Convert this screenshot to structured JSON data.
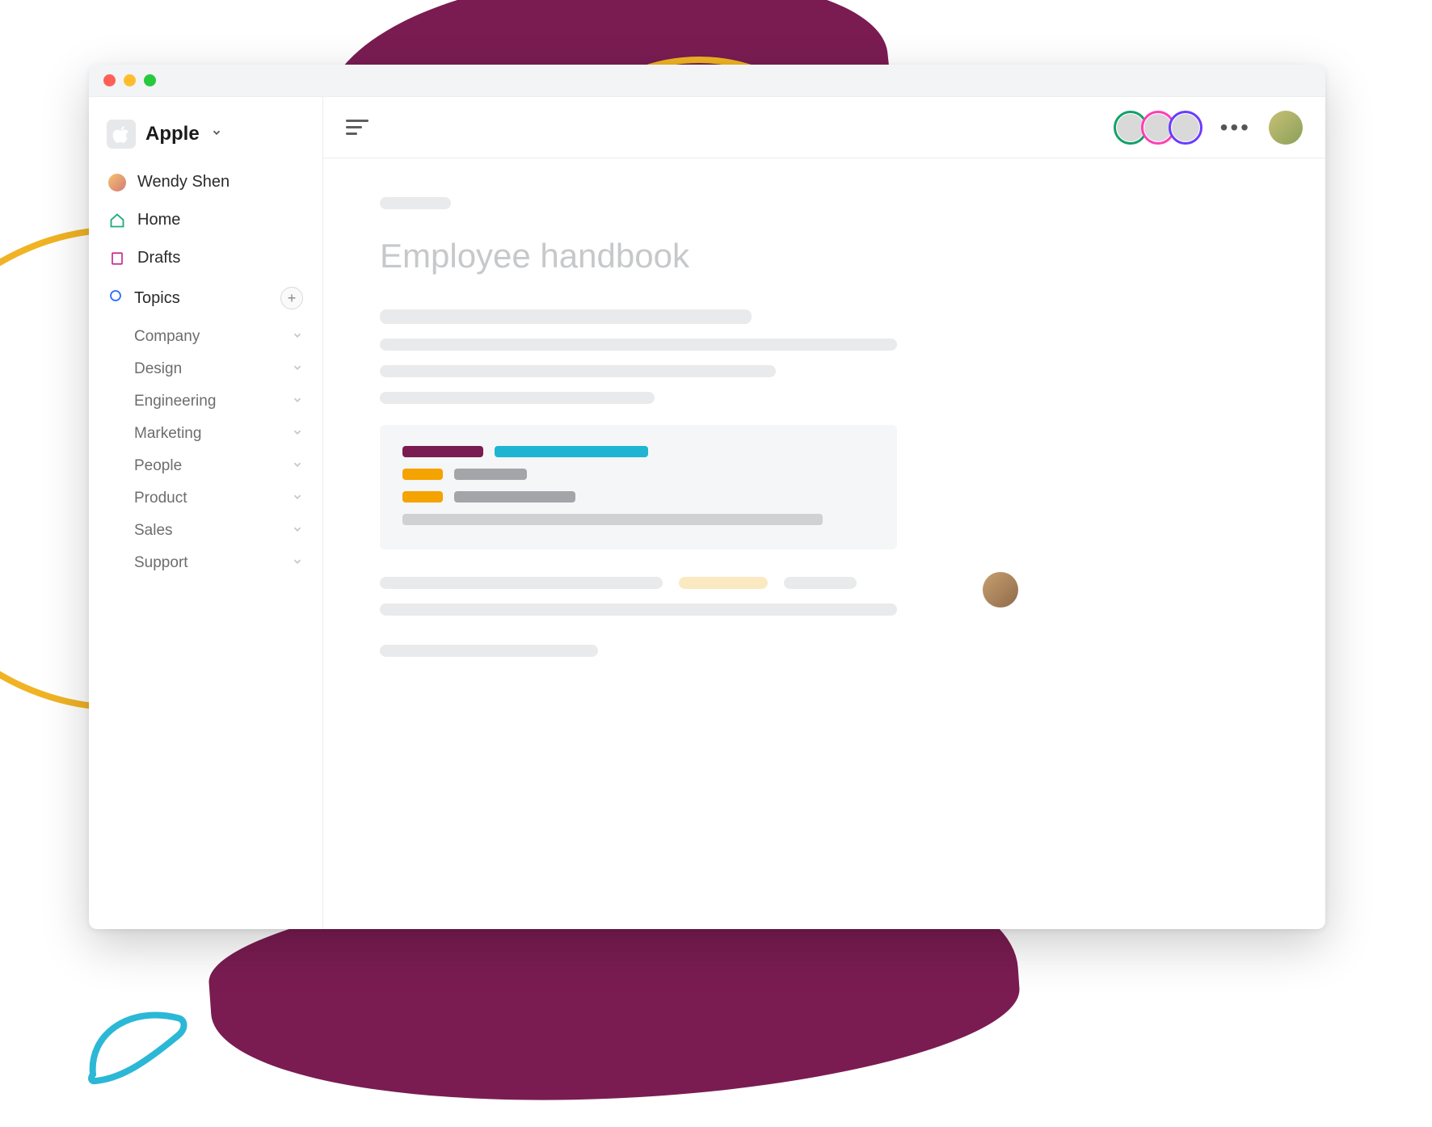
{
  "workspace": {
    "name": "Apple",
    "logo_icon": "apple-icon"
  },
  "sidebar": {
    "user_name": "Wendy Shen",
    "nav": {
      "home": "Home",
      "drafts": "Drafts",
      "topics": "Topics"
    },
    "topics": [
      {
        "label": "Company"
      },
      {
        "label": "Design"
      },
      {
        "label": "Engineering"
      },
      {
        "label": "Marketing"
      },
      {
        "label": "People"
      },
      {
        "label": "Product"
      },
      {
        "label": "Sales"
      },
      {
        "label": "Support"
      }
    ]
  },
  "topbar": {
    "presence_colors": [
      "green",
      "pink",
      "purple"
    ]
  },
  "document": {
    "title": "Employee handbook"
  },
  "colors": {
    "brand_purple": "#7a1c52",
    "accent_yellow": "#f0b323",
    "accent_cyan": "#1fb5d2",
    "accent_amber": "#f4a300"
  }
}
